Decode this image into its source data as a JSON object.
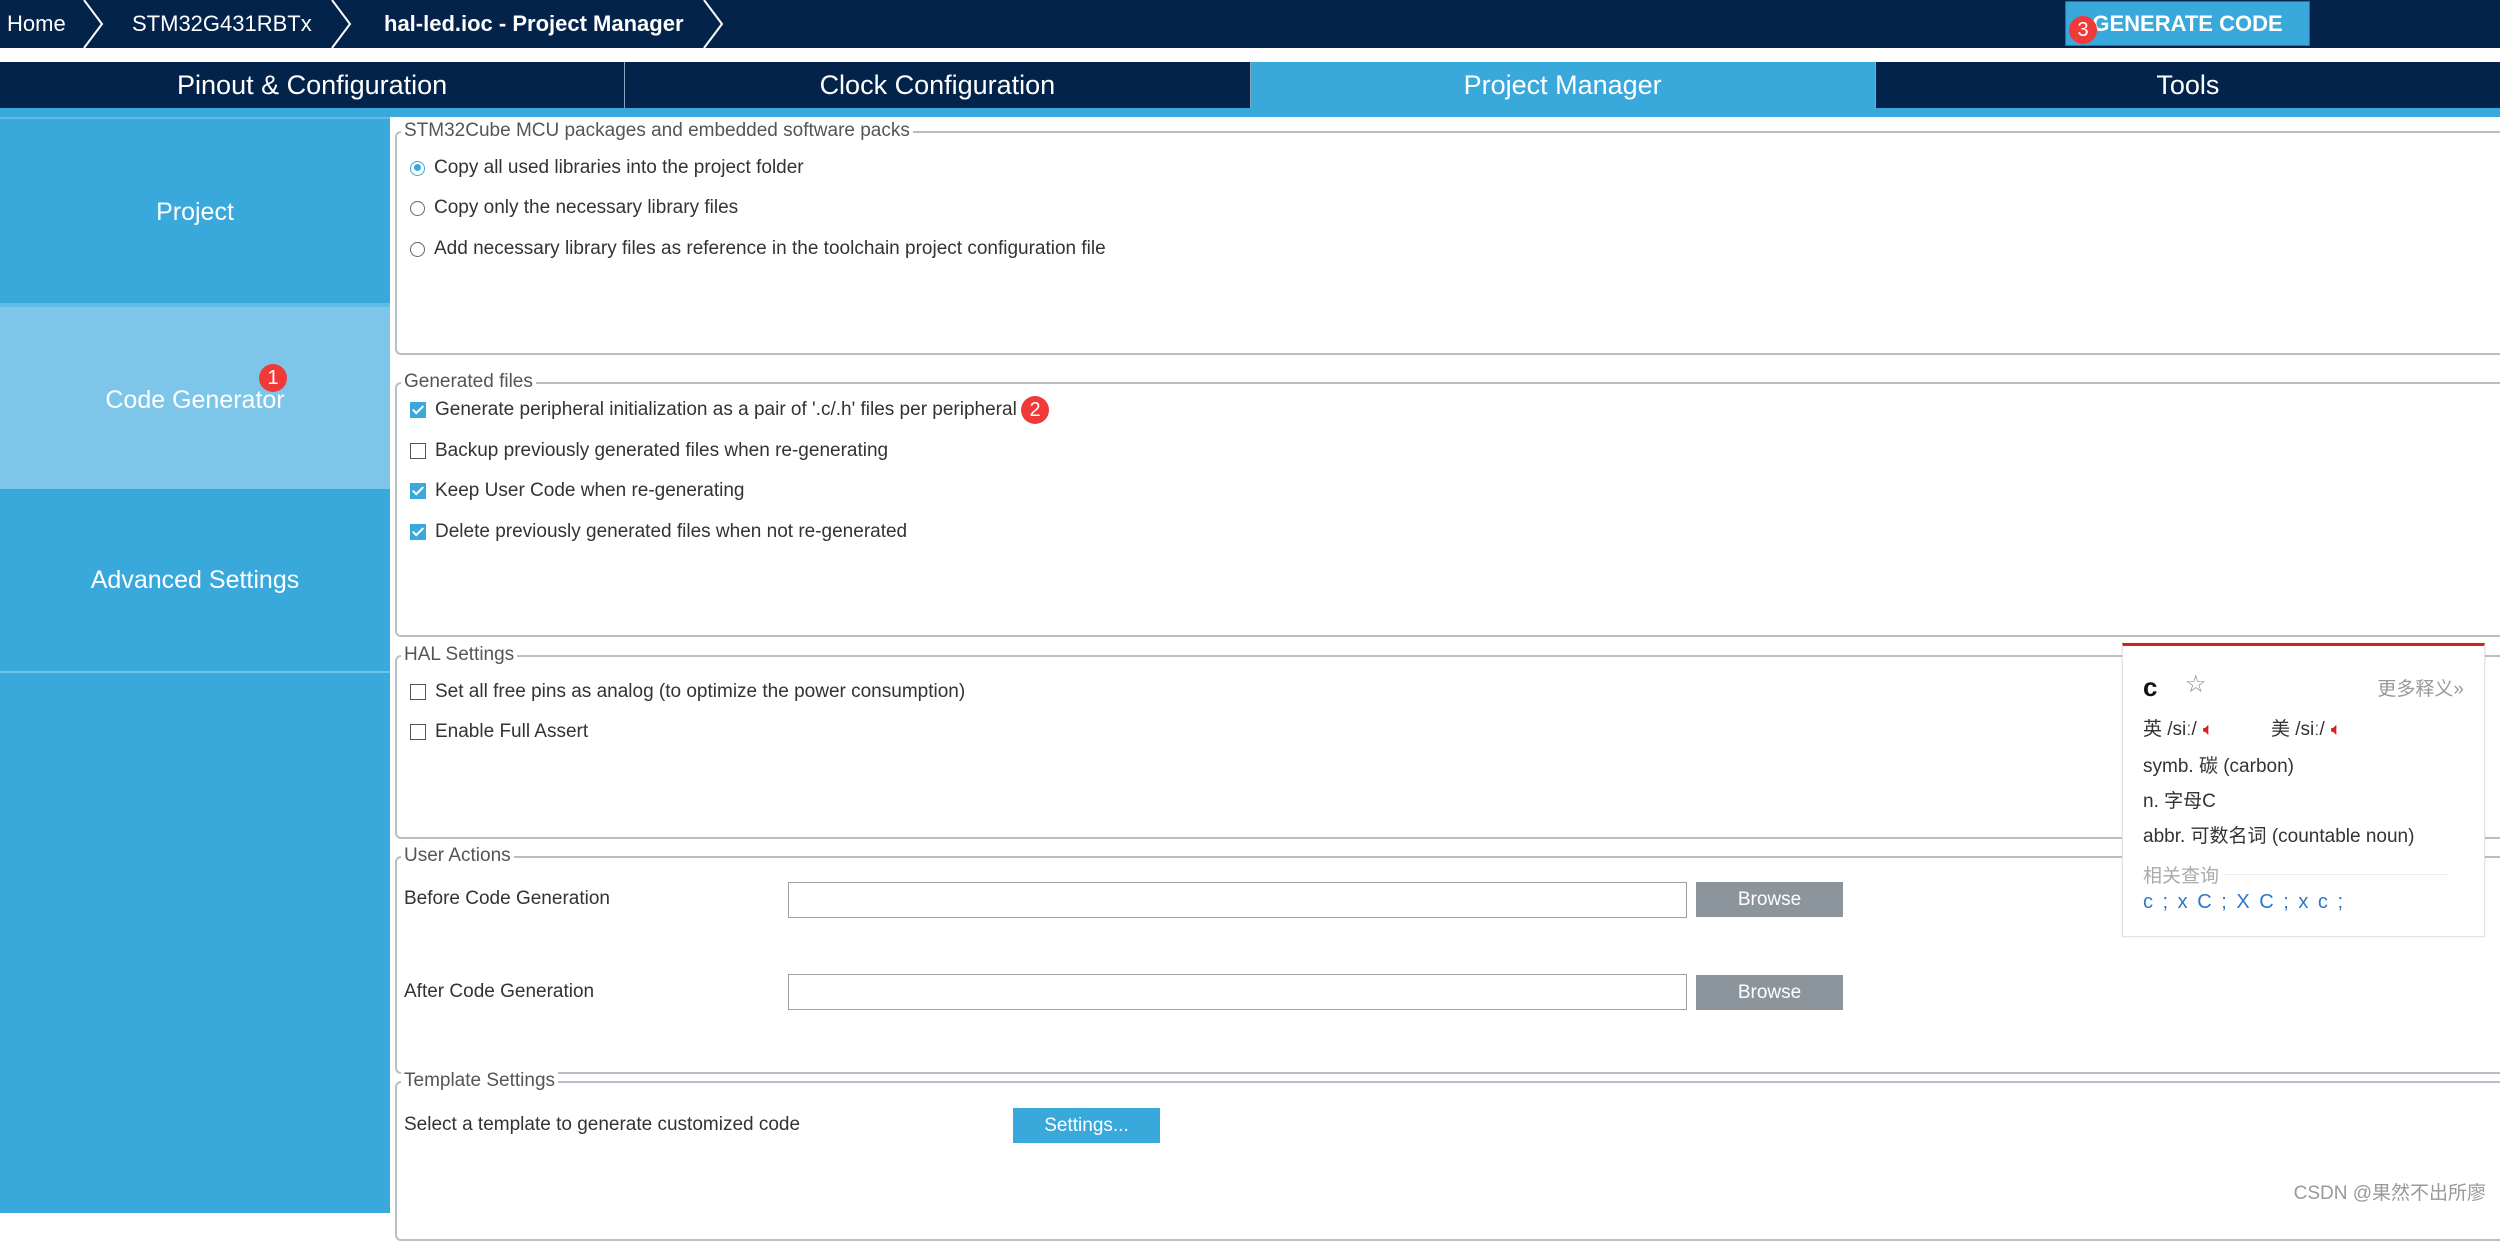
{
  "breadcrumb": {
    "items": [
      "Home",
      "STM32G431RBTx",
      "hal-led.ioc - Project Manager"
    ]
  },
  "toolbar": {
    "generate_code_label": "GENERATE CODE"
  },
  "tabs": [
    {
      "label": "Pinout & Configuration",
      "active": false
    },
    {
      "label": "Clock Configuration",
      "active": false
    },
    {
      "label": "Project Manager",
      "active": true
    },
    {
      "label": "Tools",
      "active": false
    }
  ],
  "sidebar": {
    "items": [
      {
        "label": "Project",
        "active": false
      },
      {
        "label": "Code Generator",
        "active": true
      },
      {
        "label": "Advanced Settings",
        "active": false
      }
    ]
  },
  "packages": {
    "legend": "STM32Cube MCU packages and embedded software packs",
    "options": [
      {
        "label": "Copy all used libraries into the project folder",
        "selected": true
      },
      {
        "label": "Copy only the necessary library files",
        "selected": false
      },
      {
        "label": "Add necessary library files as reference in the toolchain project configuration file",
        "selected": false
      }
    ]
  },
  "generated_files": {
    "legend": "Generated files",
    "options": [
      {
        "label": "Generate peripheral initialization as a pair of '.c/.h' files per peripheral",
        "checked": true
      },
      {
        "label": "Backup previously generated files when re-generating",
        "checked": false
      },
      {
        "label": "Keep User Code when re-generating",
        "checked": true
      },
      {
        "label": "Delete previously generated files when not re-generated",
        "checked": true
      }
    ]
  },
  "hal_settings": {
    "legend": "HAL Settings",
    "options": [
      {
        "label": "Set all free pins as analog (to optimize the power consumption)",
        "checked": false
      },
      {
        "label": "Enable Full Assert",
        "checked": false
      }
    ]
  },
  "user_actions": {
    "legend": "User Actions",
    "before_label": "Before Code Generation",
    "before_value": "",
    "after_label": "After Code Generation",
    "after_value": "",
    "browse_label": "Browse"
  },
  "template_settings": {
    "legend": "Template Settings",
    "label": "Select a template to generate customized code",
    "button_label": "Settings..."
  },
  "annotations": [
    "1",
    "2",
    "3"
  ],
  "dictionary_popup": {
    "word": "c",
    "more_label": "更多释义»",
    "uk_label": "英 /siː/",
    "us_label": "美 /siː/",
    "definitions": [
      "symb. 碳 (carbon)",
      "n. 字母C",
      "abbr. 可数名词 (countable noun)"
    ],
    "related_title": "相关查询",
    "related": "c ; x C ; X C ; x c ;"
  },
  "watermark": "CSDN @果然不出所廖",
  "colors": {
    "navy": "#03234b",
    "accent_blue": "#39a8db",
    "sidebar_active": "#7dc6ea",
    "badge_red": "#f03a3a",
    "browse_gray": "#8d959c"
  }
}
